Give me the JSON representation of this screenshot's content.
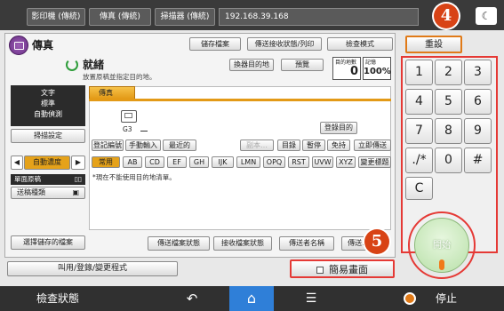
{
  "topbar": {
    "tabs": [
      "影印機 (傳統)",
      "傳真 (傳統)",
      "掃描器 (傳統)"
    ],
    "ip": "192.168.39.168",
    "moon_icon": "moon-icon"
  },
  "header": {
    "app_title": "傳真",
    "save_file": "儲存檔案",
    "send_receive": "傳送接收狀態/列印",
    "check_mode": "檢查模式",
    "reset": "重設"
  },
  "status": {
    "title": "就緒",
    "subtitle": "放置原稿並指定目的地。",
    "switch_dest": "換器目的地",
    "preview": "預覽",
    "dest_label": "目的地數",
    "dest_count": "0",
    "memory_label": "記憶",
    "memory_value": "100%"
  },
  "left_panel": {
    "settings_lines": [
      "文字",
      "標準",
      "自動偵測"
    ],
    "scan_settings": "掃描設定",
    "auto_density": "自動濃度",
    "single_side": "單面原稿",
    "send_type": "送稿種類",
    "select_stored": "選擇儲存的檔案"
  },
  "dest_area": {
    "fax_tab": "傳真",
    "g3_label": "G3",
    "register_dest": "登錄目的",
    "row1": [
      "登記編號",
      "手動輸入",
      "最近的"
    ],
    "row1_right": [
      "目錄",
      "暫停",
      "免持",
      "立即傳送"
    ],
    "row1_dim": "副本…",
    "alpha_row": [
      "常用",
      "AB",
      "CD",
      "EF",
      "GH",
      "IJK",
      "LMN",
      "OPQ",
      "RST",
      "UVW",
      "XYZ",
      "變更標題"
    ],
    "notice": "*現在不能使用目的地清單。"
  },
  "bottom_buttons": [
    "傳送檔案狀態",
    "接收檔案狀態",
    "傳送者名稱",
    "傳送..."
  ],
  "footer_row": {
    "program": "叫用/登錄/變更程式",
    "simple_screen": "簡易畫面"
  },
  "keypad": {
    "keys": [
      "1",
      "2",
      "3",
      "4",
      "5",
      "6",
      "7",
      "8",
      "9",
      "./*",
      "0",
      "#",
      "C"
    ],
    "start": "開始"
  },
  "badges": {
    "four": "4",
    "five": "5"
  },
  "bottombar": {
    "check_status": "檢查狀態",
    "stop": "停止"
  }
}
